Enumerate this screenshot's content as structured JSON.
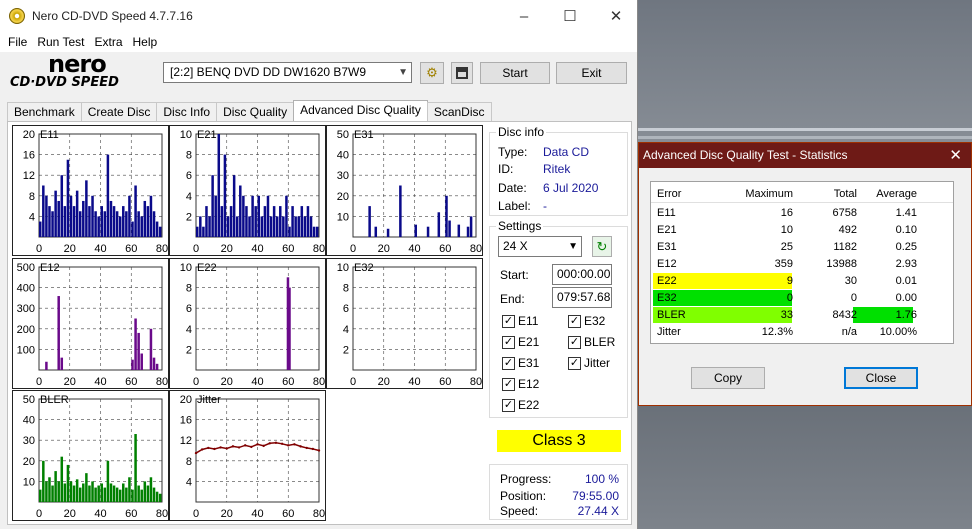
{
  "window": {
    "title": "Nero CD-DVD Speed 4.7.7.16"
  },
  "menu": [
    "File",
    "Run Test",
    "Extra",
    "Help"
  ],
  "logo": {
    "brand": "nero",
    "product": "CD·DVD SPEED"
  },
  "toolbar": {
    "drive": "[2:2]   BENQ DVD DD DW1620 B7W9",
    "start": "Start",
    "exit": "Exit"
  },
  "tabs": [
    "Benchmark",
    "Create Disc",
    "Disc Info",
    "Disc Quality",
    "Advanced Disc Quality",
    "ScanDisc"
  ],
  "active_tab": "Advanced Disc Quality",
  "disc_info": {
    "title": "Disc info",
    "type_label": "Type:",
    "type": "Data CD",
    "id_label": "ID:",
    "id": "Ritek",
    "date_label": "Date:",
    "date": "6 Jul 2020",
    "label_label": "Label:",
    "label": "-"
  },
  "settings": {
    "title": "Settings",
    "speed": "24 X",
    "start_label": "Start:",
    "start": "000:00.00",
    "end_label": "End:",
    "end": "079:57.68",
    "checks": [
      {
        "label": "E11",
        "checked": true
      },
      {
        "label": "E32",
        "checked": true
      },
      {
        "label": "E21",
        "checked": true
      },
      {
        "label": "BLER",
        "checked": true
      },
      {
        "label": "E31",
        "checked": true
      },
      {
        "label": "Jitter",
        "checked": true
      },
      {
        "label": "E12",
        "checked": true
      },
      {
        "label": "E22",
        "checked": true
      }
    ]
  },
  "class": "Class 3",
  "progress": {
    "progress_label": "Progress:",
    "progress": "100 %",
    "position_label": "Position:",
    "position": "79:55.00",
    "speed_label": "Speed:",
    "speed": "27.44 X"
  },
  "stats": {
    "title": "Advanced Disc Quality Test - Statistics",
    "headers": [
      "Error",
      "Maximum",
      "Total",
      "Average"
    ],
    "rows": [
      {
        "error": "E11",
        "max": "16",
        "total": "6758",
        "avg": "1.41",
        "max_color": "",
        "avg_color": ""
      },
      {
        "error": "E21",
        "max": "10",
        "total": "492",
        "avg": "0.10",
        "max_color": "",
        "avg_color": ""
      },
      {
        "error": "E31",
        "max": "25",
        "total": "1182",
        "avg": "0.25",
        "max_color": "",
        "avg_color": ""
      },
      {
        "error": "E12",
        "max": "359",
        "total": "13988",
        "avg": "2.93",
        "max_color": "",
        "avg_color": ""
      },
      {
        "error": "E22",
        "max": "9",
        "total": "30",
        "avg": "0.01",
        "max_color": "#ffff00",
        "avg_color": ""
      },
      {
        "error": "E32",
        "max": "0",
        "total": "0",
        "avg": "0.00",
        "max_color": "#00e000",
        "avg_color": ""
      },
      {
        "error": "BLER",
        "max": "33",
        "total": "8432",
        "avg": "1.76",
        "max_color": "#80ff00",
        "avg_color": "#00e000"
      },
      {
        "error": "Jitter",
        "max": "12.3%",
        "total": "n/a",
        "avg": "10.00%",
        "max_color": "",
        "avg_color": ""
      }
    ],
    "copy": "Copy",
    "close": "Close"
  },
  "chart_data": [
    {
      "type": "bar",
      "title": "E11",
      "ylim": [
        0,
        20
      ],
      "yticks": [
        4,
        8,
        12,
        16,
        20
      ],
      "xticks": [
        0,
        20,
        40,
        60,
        80
      ],
      "color": "#0a0a8a",
      "x": [
        0,
        2,
        4,
        6,
        8,
        10,
        12,
        14,
        16,
        18,
        20,
        22,
        24,
        26,
        28,
        30,
        32,
        34,
        36,
        38,
        40,
        42,
        44,
        46,
        48,
        50,
        52,
        54,
        56,
        58,
        60,
        62,
        64,
        66,
        68,
        70,
        72,
        74,
        76,
        78
      ],
      "values": [
        3,
        10,
        8,
        6,
        5,
        9,
        7,
        12,
        6,
        15,
        8,
        6,
        9,
        5,
        7,
        11,
        6,
        8,
        5,
        4,
        6,
        5,
        16,
        7,
        6,
        5,
        4,
        6,
        5,
        8,
        3,
        10,
        5,
        4,
        7,
        6,
        8,
        5,
        3,
        2
      ]
    },
    {
      "type": "bar",
      "title": "E21",
      "ylim": [
        0,
        10
      ],
      "yticks": [
        2,
        4,
        6,
        8,
        10
      ],
      "xticks": [
        0,
        20,
        40,
        60,
        80
      ],
      "color": "#0a0a8a",
      "x": [
        0,
        2,
        4,
        6,
        8,
        10,
        12,
        14,
        16,
        18,
        20,
        22,
        24,
        26,
        28,
        30,
        32,
        34,
        36,
        38,
        40,
        42,
        44,
        46,
        48,
        50,
        52,
        54,
        56,
        58,
        60,
        62,
        64,
        66,
        68,
        70,
        72,
        74,
        76,
        78
      ],
      "values": [
        1,
        2,
        1,
        3,
        2,
        6,
        4,
        10,
        3,
        8,
        2,
        3,
        6,
        2,
        5,
        4,
        3,
        2,
        4,
        3,
        4,
        2,
        3,
        4,
        2,
        3,
        2,
        3,
        2,
        4,
        1,
        3,
        2,
        2,
        3,
        2,
        3,
        2,
        1,
        1
      ]
    },
    {
      "type": "bar",
      "title": "E31",
      "ylim": [
        0,
        50
      ],
      "yticks": [
        10,
        20,
        30,
        40,
        50
      ],
      "xticks": [
        0,
        20,
        40,
        60,
        80
      ],
      "color": "#0a0a8a",
      "x": [
        10,
        14,
        22,
        30,
        40,
        48,
        55,
        60,
        62,
        68,
        74,
        76
      ],
      "values": [
        15,
        5,
        4,
        25,
        6,
        5,
        12,
        20,
        8,
        6,
        5,
        10
      ]
    },
    {
      "type": "bar",
      "title": "E12",
      "ylim": [
        0,
        500
      ],
      "yticks": [
        100,
        200,
        300,
        400,
        500
      ],
      "xticks": [
        0,
        20,
        40,
        60,
        80
      ],
      "color": "#6a0a8a",
      "x": [
        4,
        12,
        14,
        60,
        62,
        64,
        66,
        72,
        74,
        76
      ],
      "values": [
        40,
        359,
        60,
        50,
        250,
        180,
        80,
        200,
        60,
        30
      ]
    },
    {
      "type": "bar",
      "title": "E22",
      "ylim": [
        0,
        10
      ],
      "yticks": [
        2,
        4,
        6,
        8,
        10
      ],
      "xticks": [
        0,
        20,
        40,
        60,
        80
      ],
      "color": "#6a0a8a",
      "x": [
        59,
        60
      ],
      "values": [
        9,
        8
      ]
    },
    {
      "type": "bar",
      "title": "E32",
      "ylim": [
        0,
        10
      ],
      "yticks": [
        2,
        4,
        6,
        8,
        10
      ],
      "xticks": [
        0,
        20,
        40,
        60,
        80
      ],
      "color": "#6a0a8a",
      "x": [],
      "values": []
    },
    {
      "type": "bar",
      "title": "BLER",
      "ylim": [
        0,
        50
      ],
      "yticks": [
        10,
        20,
        30,
        40,
        50
      ],
      "xticks": [
        0,
        20,
        40,
        60,
        80
      ],
      "color": "#008000",
      "x": [
        0,
        2,
        4,
        6,
        8,
        10,
        12,
        14,
        16,
        18,
        20,
        22,
        24,
        26,
        28,
        30,
        32,
        34,
        36,
        38,
        40,
        42,
        44,
        46,
        48,
        50,
        52,
        54,
        56,
        58,
        60,
        62,
        64,
        66,
        68,
        70,
        72,
        74,
        76,
        78
      ],
      "values": [
        6,
        20,
        10,
        12,
        8,
        15,
        10,
        22,
        9,
        18,
        10,
        8,
        11,
        7,
        9,
        14,
        8,
        10,
        7,
        8,
        9,
        7,
        20,
        9,
        8,
        7,
        6,
        9,
        7,
        12,
        6,
        33,
        8,
        6,
        10,
        8,
        12,
        7,
        5,
        4
      ]
    },
    {
      "type": "line",
      "title": "Jitter",
      "ylim": [
        0,
        20
      ],
      "yticks": [
        4,
        8,
        12,
        16,
        20
      ],
      "xticks": [
        0,
        20,
        40,
        60,
        80
      ],
      "color": "#800000",
      "x": [
        0,
        4,
        8,
        12,
        16,
        20,
        24,
        28,
        32,
        36,
        40,
        44,
        48,
        52,
        56,
        60,
        64,
        68,
        72,
        76,
        80
      ],
      "values": [
        9.5,
        10.2,
        10.5,
        10.3,
        10.6,
        10.4,
        10.8,
        10.6,
        11.0,
        10.7,
        11.2,
        10.9,
        11.4,
        11.5,
        11.3,
        11.0,
        11.2,
        10.8,
        10.5,
        10.3,
        10.0
      ]
    }
  ]
}
